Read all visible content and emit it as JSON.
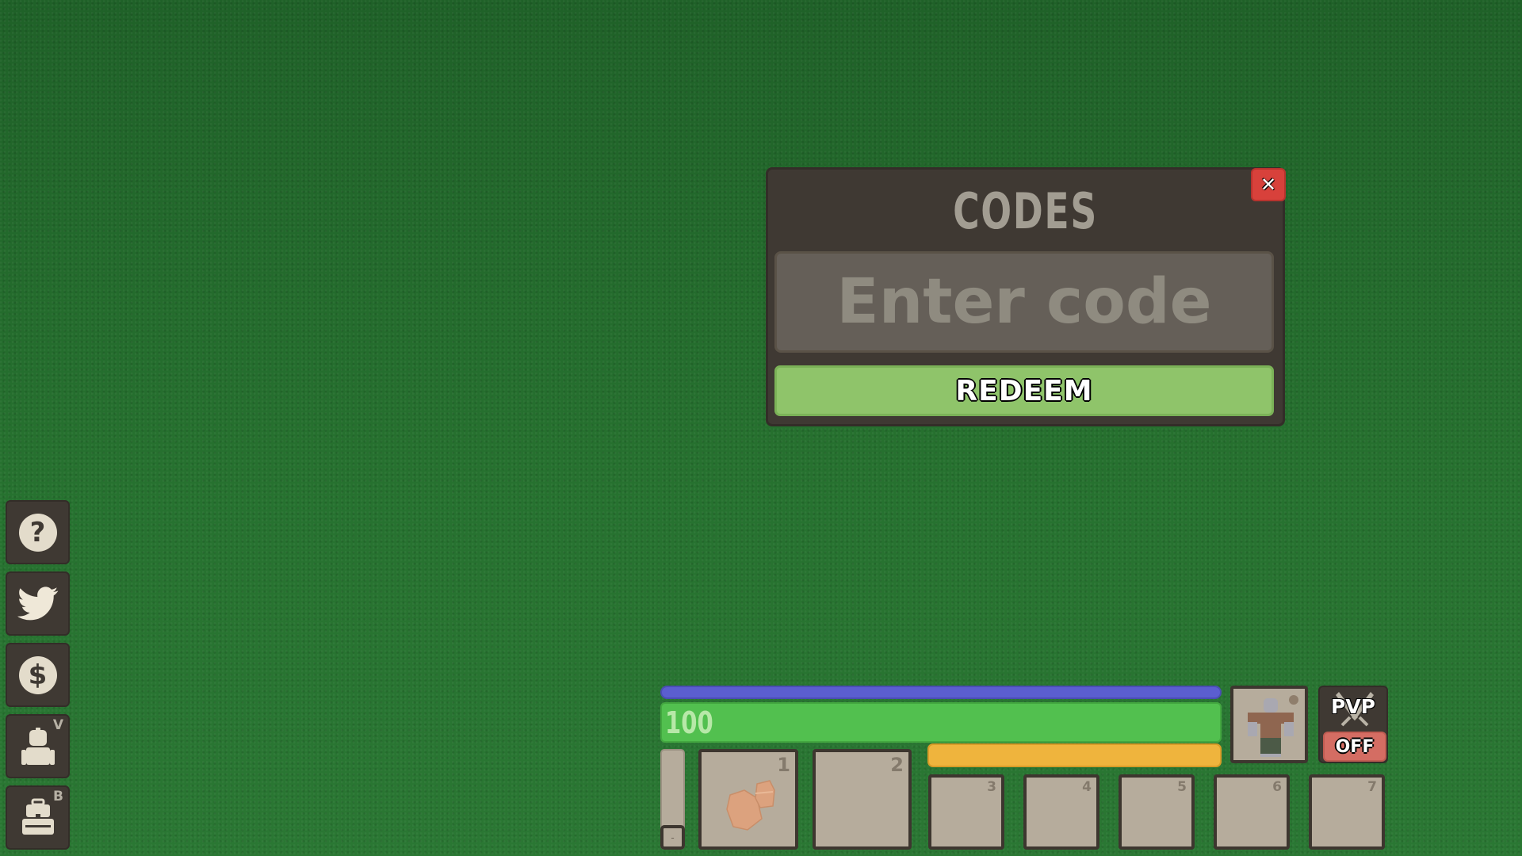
{
  "codes_modal": {
    "title": "CODES",
    "input_placeholder": "Enter code",
    "input_value": "",
    "redeem_label": "REDEEM",
    "close_icon": "close-x-icon"
  },
  "sidebar": {
    "items": [
      {
        "name": "help",
        "icon": "question-icon",
        "glyph": "?",
        "key": ""
      },
      {
        "name": "twitter",
        "icon": "twitter-bird-icon",
        "key": ""
      },
      {
        "name": "shop",
        "icon": "dollar-icon",
        "glyph": "$",
        "key": ""
      },
      {
        "name": "character",
        "icon": "character-icon",
        "key": "V"
      },
      {
        "name": "backpack",
        "icon": "backpack-icon",
        "key": "B"
      }
    ]
  },
  "hud": {
    "health_value": "100",
    "health_fraction": 1.0,
    "blue_bar_fraction": 1.0,
    "hunger_bar_fraction": 1.0,
    "pvp_label": "PVP",
    "pvp_state": "OFF",
    "thin_slot_label": "-",
    "colors": {
      "blue": "#5b5ed0",
      "green": "#52c04f",
      "yellow": "#efb43d",
      "close_red": "#d8413b",
      "redeem_green": "#8fc46a",
      "pvp_off_red": "#d46d63"
    }
  },
  "hotbar": {
    "slots": [
      {
        "number": "1",
        "item": "crafting-material-icon"
      },
      {
        "number": "2",
        "item": ""
      },
      {
        "number": "3",
        "item": ""
      },
      {
        "number": "4",
        "item": ""
      },
      {
        "number": "5",
        "item": ""
      },
      {
        "number": "6",
        "item": ""
      },
      {
        "number": "7",
        "item": ""
      }
    ]
  }
}
